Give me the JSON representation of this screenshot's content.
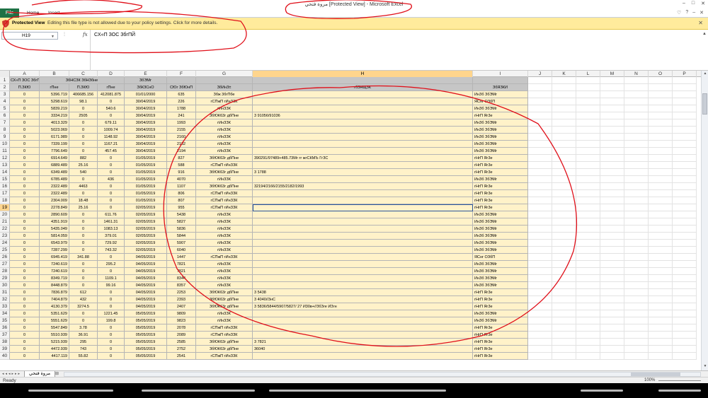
{
  "window": {
    "title": "مروة فتحي  [Protected View]  -  Microsoft Excel",
    "controls": [
      "–",
      "□",
      "✕"
    ]
  },
  "ribbon": {
    "file_tab": "File",
    "tabs": [
      "Home",
      "Insert"
    ],
    "right_icons": [
      "♡",
      "?",
      "–",
      "✕"
    ]
  },
  "protected_view": {
    "title": "Protected View",
    "message": "Editing this file type is not allowed due to your policy settings. Click for more details.",
    "close": "✕"
  },
  "formula_bar": {
    "name_box": "H19",
    "fx": "fx",
    "formula": "CX«П ЗОС ЗбгПЙ"
  },
  "columns": [
    "A",
    "B",
    "C",
    "D",
    "E",
    "F",
    "G",
    "H",
    "I",
    "J",
    "K",
    "L",
    "M",
    "N",
    "O",
    "P"
  ],
  "selected_column": "H",
  "selected_row": "19",
  "header_row1": {
    "a": "СХ«П ЗОС ЗбгПЙ",
    "c": "ЗбНСЗК ЗбНЗбне",
    "e": "ЗбЭМг"
  },
  "header_row2": [
    "П.ЗКЮ",
    "гПне",
    "П.ЗКЮ",
    "гПне",
    "ЗбКЗСнО",
    "СЮг ЗбЮнП",
    "ЗбИнЗ±",
    "гбЗНЩЗК",
    "ЗбЯЗКИ"
  ],
  "rows": [
    [
      "3",
      "0",
      "5396.719",
      "406685.156",
      "412081.875",
      "01/01/2000",
      "635",
      "Збж 3бгПбе",
      "",
      "ИнЗб ЗбЭМг"
    ],
    [
      "4",
      "0",
      "5298.619",
      "98.1",
      "0",
      "30/04/2019",
      "226",
      "гСПжП гИнЗЗК",
      "",
      "ЯСнг ОЗбП"
    ],
    [
      "5",
      "0",
      "5839.219",
      "0",
      "540.6",
      "30/04/2019",
      "1788",
      "гИнЗЗК",
      "",
      "ИнЗб ЗбЭМг"
    ],
    [
      "6",
      "0",
      "3334.219",
      "2505",
      "0",
      "30/04/2019",
      "241",
      "ЗбЮК63г дбПне",
      "3 91056/91036",
      "гНгП Яг3е"
    ],
    [
      "7",
      "0",
      "4013.329",
      "0",
      "679.11",
      "30/04/2019",
      "1993",
      "гИнЗЗК",
      "",
      "ИнЗб ЗбЭМг"
    ],
    [
      "8",
      "0",
      "5023.069",
      "0",
      "1009.74",
      "30/04/2019",
      "2155",
      "гИнЗЗК",
      "",
      "ИнЗб ЗбЭМг"
    ],
    [
      "9",
      "0",
      "6171.989",
      "0",
      "1148.92",
      "30/04/2019",
      "2160",
      "гИнЗЗК",
      "",
      "ИнЗб ЗбЭМг"
    ],
    [
      "10",
      "0",
      "7339.199",
      "0",
      "1167.21",
      "30/04/2019",
      "2182",
      "гИнЗЗК",
      "",
      "ИнЗб ЗбЭМг"
    ],
    [
      "11",
      "0",
      "7796.649",
      "0",
      "457.45",
      "30/04/2019",
      "2194",
      "гИнЗЗК",
      "",
      "ИнЗб ЗбЭМг"
    ],
    [
      "12",
      "0",
      "6914.649",
      "882",
      "0",
      "01/05/2019",
      "827",
      "ЗбЮК63г дбПне",
      "390291/97489+485.73Мг гг жгСКМЪ ГгЗС",
      "гНгП Яг3е"
    ],
    [
      "13",
      "0",
      "6889.489",
      "25.16",
      "0",
      "01/05/2019",
      "588",
      "гСПжП гИнЗЗК",
      "",
      "гНгП Яг3е"
    ],
    [
      "14",
      "0",
      "6349.489",
      "540",
      "0",
      "01/05/2019",
      "916",
      "ЗбЮК63г дбПне",
      "3 1788",
      "гНгП Яг3е"
    ],
    [
      "15",
      "0",
      "6785.489",
      "0",
      "436",
      "01/05/2019",
      "4070",
      "гИнЗЗК",
      "",
      "ИнЗб ЗбЭМг"
    ],
    [
      "16",
      "0",
      "2322.489",
      "4463",
      "0",
      "01/05/2019",
      "1107",
      "ЗбЮК63г дбПне",
      "32194/2166/2155/2182/1993",
      "гНгП Яг3е"
    ],
    [
      "17",
      "0",
      "2322.489",
      "0",
      "0",
      "01/05/2019",
      "806",
      "гСПжП гИнЗЗК",
      "",
      "гНгП Яг3е"
    ],
    [
      "18",
      "0",
      "2304.009",
      "18.48",
      "0",
      "01/05/2019",
      "807",
      "гСПжП гИнЗЗК",
      "",
      "гНгП Яг3е"
    ],
    [
      "19",
      "0",
      "2278.849",
      "25.16",
      "0",
      "02/05/2019",
      "955",
      "гСПжП гИнЗЗК",
      "",
      "гНгП Яг3е"
    ],
    [
      "20",
      "0",
      "2890.609",
      "0",
      "611.76",
      "02/05/2019",
      "5438",
      "гИнЗЗК",
      "",
      "ИнЗб ЗбЭМг"
    ],
    [
      "21",
      "0",
      "4351.919",
      "0",
      "1461.31",
      "02/05/2019",
      "5827",
      "гИнЗЗК",
      "",
      "ИнЗб ЗбЭМг"
    ],
    [
      "22",
      "0",
      "5435.049",
      "0",
      "1083.13",
      "02/05/2019",
      "5836",
      "гИнЗЗК",
      "",
      "ИнЗб ЗбЭМг"
    ],
    [
      "23",
      "0",
      "5814.059",
      "0",
      "379.01",
      "02/05/2019",
      "5844",
      "гИнЗЗК",
      "",
      "ИнЗб ЗбЭМг"
    ],
    [
      "24",
      "0",
      "6543.979",
      "0",
      "729.92",
      "02/05/2019",
      "5907",
      "гИнЗЗК",
      "",
      "ИнЗб ЗбЭМг"
    ],
    [
      "25",
      "0",
      "7287.299",
      "0",
      "743.32",
      "02/05/2019",
      "6040",
      "гИнЗЗК",
      "",
      "ИнЗб ЗбЭМг"
    ],
    [
      "26",
      "0",
      "6945.419",
      "341.88",
      "0",
      "04/05/2019",
      "1447",
      "гСПжП гИнЗЗК",
      "",
      "ЯСнг ОЗбП"
    ],
    [
      "27",
      "0",
      "7240.619",
      "0",
      "295.2",
      "04/05/2019",
      "7821",
      "гИнЗЗК",
      "",
      "ИнЗб ЗбЭМг"
    ],
    [
      "28",
      "0",
      "7240.619",
      "0",
      "0",
      "04/05/2019",
      "7821",
      "гИнЗЗК",
      "",
      "ИнЗб ЗбЭМг"
    ],
    [
      "29",
      "0",
      "8349.719",
      "0",
      "1109.1",
      "04/05/2019",
      "8344",
      "гИнЗЗК",
      "",
      "ИнЗб ЗбЭМг"
    ],
    [
      "30",
      "0",
      "8448.879",
      "0",
      "99.16",
      "04/05/2019",
      "8357",
      "гИнЗЗК",
      "",
      "ИнЗб ЗбЭМг"
    ],
    [
      "31",
      "0",
      "7836.879",
      "612",
      "0",
      "04/05/2019",
      "2253",
      "ЗбЮК63г дбПне",
      "3 5438",
      "гНгП Яг3е"
    ],
    [
      "32",
      "0",
      "7404.879",
      "432",
      "0",
      "04/05/2019",
      "2393",
      "ЗбЮК63г дбПне",
      "3 4040//3нС",
      "гНгП Яг3е"
    ],
    [
      "33",
      "0",
      "4130.379",
      "3274.5",
      "0",
      "04/05/2019",
      "2407",
      "ЗбЮК63г дбПне",
      "3 5836/5844/5907/5827/ 27 И30в+//ЗбЗге ИЗгн",
      "гНгП Яг3е"
    ],
    [
      "34",
      "0",
      "5351.629",
      "0",
      "1221.45",
      "05/05/2019",
      "9809",
      "гИнЗЗК",
      "",
      "ИнЗб ЗбЭМг"
    ],
    [
      "35",
      "0",
      "5551.629",
      "0",
      "199.8",
      "05/05/2019",
      "9823",
      "гИнЗЗК",
      "",
      "ИнЗб ЗбЭМг"
    ],
    [
      "36",
      "0",
      "5547.849",
      "3.78",
      "0",
      "05/05/2019",
      "2078",
      "гСПжП гИнЗЗК",
      "",
      "гНгП Яг3е"
    ],
    [
      "37",
      "0",
      "5510.939",
      "36.91",
      "0",
      "05/05/2019",
      "2089",
      "гСПжП гИнЗЗК",
      "",
      "гНгП Яг3е"
    ],
    [
      "38",
      "0",
      "5215.939",
      "295",
      "0",
      "05/05/2019",
      "2585",
      "ЗбЮК63г дбПне",
      "3 7821",
      "гНгП Яг3е"
    ],
    [
      "39",
      "0",
      "4472.939",
      "743",
      "0",
      "05/05/2019",
      "2752",
      "ЗбЮК63г дбПне",
      "36040",
      "гНгП Яг3е"
    ],
    [
      "40",
      "0",
      "4417.119",
      "55.82",
      "0",
      "05/05/2019",
      "2541",
      "гСПжП гИнЗЗК",
      "",
      "гНгП Яг3е"
    ]
  ],
  "sheet_tab": "مروة فتحي",
  "status": {
    "ready": "Ready",
    "zoom": "100%"
  }
}
